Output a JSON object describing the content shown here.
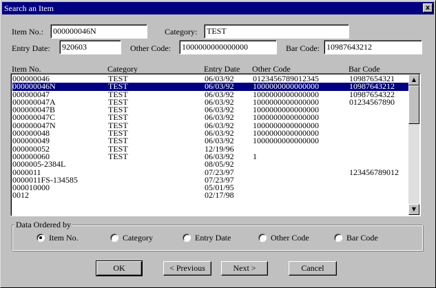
{
  "window": {
    "title": "Search an Item",
    "close_glyph": "x"
  },
  "form": {
    "item_no_label": "Item No.:",
    "item_no_value": "000000046N",
    "category_label": "Category:",
    "category_value": "TEST",
    "entry_date_label": "Entry Date:",
    "entry_date_value": "920603",
    "other_code_label": "Other Code:",
    "other_code_value": "1000000000000000",
    "bar_code_label": "Bar Code:",
    "bar_code_value": "10987643212"
  },
  "list": {
    "columns": [
      "Item No.",
      "Category",
      "Entry Date",
      "Other Code",
      "Bar Code"
    ],
    "selected_index": 1,
    "rows": [
      [
        "000000046",
        "TEST",
        "06/03/92",
        "0123456789012345",
        "10987654321"
      ],
      [
        "000000046N",
        "TEST",
        "06/03/92",
        "1000000000000000",
        "10987643212"
      ],
      [
        "000000047",
        "TEST",
        "06/03/92",
        "1000000000000000",
        "10987654322"
      ],
      [
        "000000047A",
        "TEST",
        "06/03/92",
        "1000000000000000",
        "01234567890"
      ],
      [
        "000000047B",
        "TEST",
        "06/03/92",
        "1000000000000000",
        ""
      ],
      [
        "000000047C",
        "TEST",
        "06/03/92",
        "1000000000000000",
        ""
      ],
      [
        "000000047N",
        "TEST",
        "06/03/92",
        "1000000000000000",
        ""
      ],
      [
        "000000048",
        "TEST",
        "06/03/92",
        "1000000000000000",
        ""
      ],
      [
        "000000049",
        "TEST",
        "06/03/92",
        "1000000000000000",
        ""
      ],
      [
        "000000052",
        "TEST",
        "12/19/96",
        "",
        ""
      ],
      [
        "000000060",
        "TEST",
        "06/03/92",
        "1",
        ""
      ],
      [
        "0000005-2384L",
        "",
        "08/05/92",
        "",
        ""
      ],
      [
        "0000011",
        "",
        "07/23/97",
        "",
        "123456789012"
      ],
      [
        "0000011FS-134585",
        "",
        "07/23/97",
        "",
        ""
      ],
      [
        "000010000",
        "",
        "05/01/95",
        "",
        ""
      ],
      [
        "0012",
        "",
        "02/17/98",
        "",
        ""
      ]
    ],
    "scroll_up_glyph": "▲",
    "scroll_down_glyph": "▼"
  },
  "order": {
    "group_label": "Data Ordered by",
    "options": [
      "Item No.",
      "Category",
      "Entry Date",
      "Other Code",
      "Bar Code"
    ],
    "selected": 0
  },
  "buttons": {
    "ok": "OK",
    "previous": "< Previous",
    "next": "Next >",
    "cancel": "Cancel"
  }
}
